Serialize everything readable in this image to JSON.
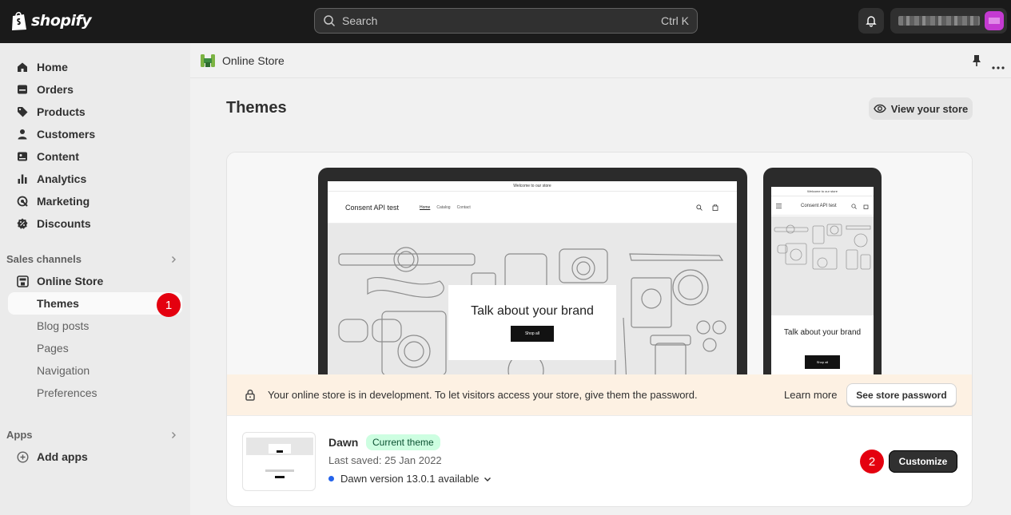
{
  "topbar": {
    "logo_text": "shopify",
    "search_placeholder": "Search",
    "search_shortcut": "Ctrl K"
  },
  "sidebar": {
    "items": [
      {
        "label": "Home",
        "icon": "home-icon"
      },
      {
        "label": "Orders",
        "icon": "orders-icon"
      },
      {
        "label": "Products",
        "icon": "tag-icon"
      },
      {
        "label": "Customers",
        "icon": "person-icon"
      },
      {
        "label": "Content",
        "icon": "content-icon"
      },
      {
        "label": "Analytics",
        "icon": "bar-chart-icon"
      },
      {
        "label": "Marketing",
        "icon": "target-icon"
      },
      {
        "label": "Discounts",
        "icon": "discount-icon"
      }
    ],
    "sales_channels_label": "Sales channels",
    "online_store_label": "Online Store",
    "sub_items": [
      "Themes",
      "Blog posts",
      "Pages",
      "Navigation",
      "Preferences"
    ],
    "apps_label": "Apps",
    "add_apps_label": "Add apps",
    "step_badges": [
      "1",
      "2"
    ]
  },
  "breadcrumb": {
    "title": "Online Store"
  },
  "page": {
    "title": "Themes",
    "view_store_label": "View your store"
  },
  "preview": {
    "announcement": "Welcome to our store",
    "store_name": "Consent API test",
    "nav_links": [
      "Home",
      "Catalog",
      "Contact"
    ],
    "hero_text": "Talk about your brand",
    "hero_button": "Shop all",
    "mobile_hero_text": "Talk about your brand"
  },
  "banner": {
    "message": "Your online store is in development. To let visitors access your store, give them the password.",
    "learn_more": "Learn more",
    "password_button": "See store password"
  },
  "theme": {
    "name": "Dawn",
    "badge": "Current theme",
    "last_saved": "Last saved: 25 Jan 2022",
    "version": "Dawn version 13.0.1 available",
    "customize_label": "Customize"
  },
  "colors": {
    "topbar": "#1a1a1a",
    "sidebar": "#ebebeb",
    "badge_red": "#e4000f",
    "current_badge_bg": "#cdfee1",
    "banner_bg": "#fdf1e3",
    "version_dot": "#2463eb"
  }
}
